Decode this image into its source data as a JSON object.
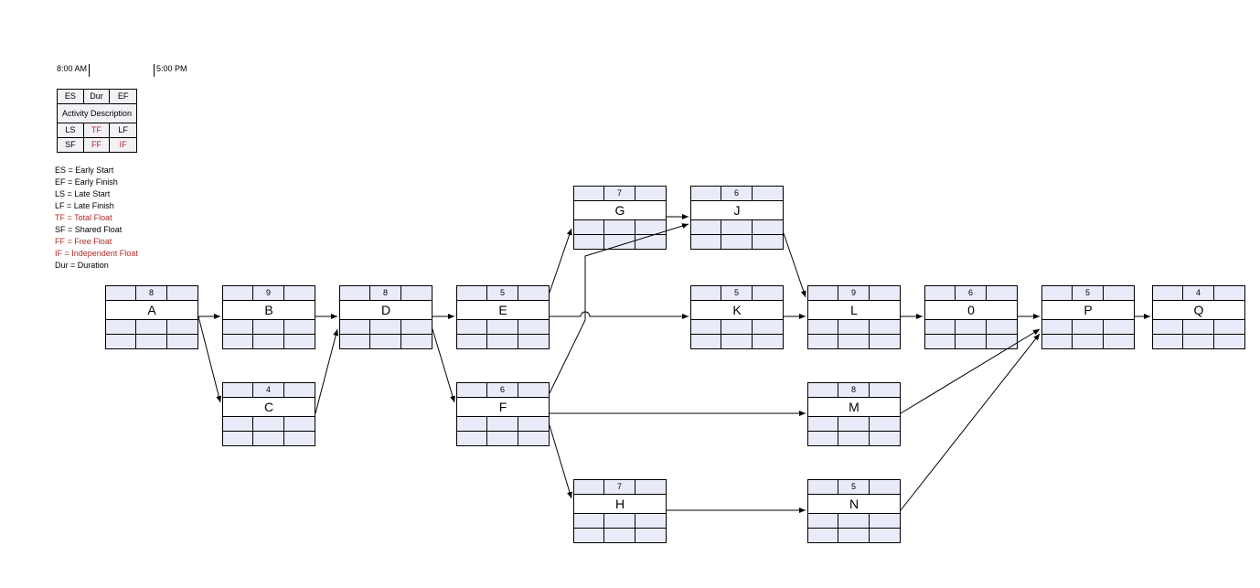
{
  "time_start": "8:00 AM",
  "time_end": "5:00 PM",
  "legend_top": {
    "es": "ES",
    "dur": "Dur",
    "ef": "EF"
  },
  "legend_act": "Activity Description",
  "legend_mid": {
    "ls": "LS",
    "tf": "TF",
    "lf": "LF"
  },
  "legend_bot": {
    "sf": "SF",
    "ff": "FF",
    "ifl": "IF"
  },
  "defs": {
    "es": "ES = Early Start",
    "ef": "EF = Early Finish",
    "ls": "LS = Late Start",
    "lf": "LF = Late Finish",
    "tf": "TF = Total Float",
    "sf": "SF = Shared Float",
    "ff": "FF = Free Float",
    "if": "IF = Independent Float",
    "dur": "Dur = Duration"
  },
  "acts": {
    "A": {
      "name": "A",
      "dur": "8"
    },
    "B": {
      "name": "B",
      "dur": "9"
    },
    "C": {
      "name": "C",
      "dur": "4"
    },
    "D": {
      "name": "D",
      "dur": "8"
    },
    "E": {
      "name": "E",
      "dur": "5"
    },
    "F": {
      "name": "F",
      "dur": "6"
    },
    "G": {
      "name": "G",
      "dur": "7"
    },
    "H": {
      "name": "H",
      "dur": "7"
    },
    "J": {
      "name": "J",
      "dur": "6"
    },
    "K": {
      "name": "K",
      "dur": "5"
    },
    "L": {
      "name": "L",
      "dur": "9"
    },
    "M": {
      "name": "M",
      "dur": "8"
    },
    "N": {
      "name": "N",
      "dur": "5"
    },
    "O": {
      "name": "0",
      "dur": "6"
    },
    "P": {
      "name": "P",
      "dur": "5"
    },
    "Q": {
      "name": "Q",
      "dur": "4"
    }
  }
}
